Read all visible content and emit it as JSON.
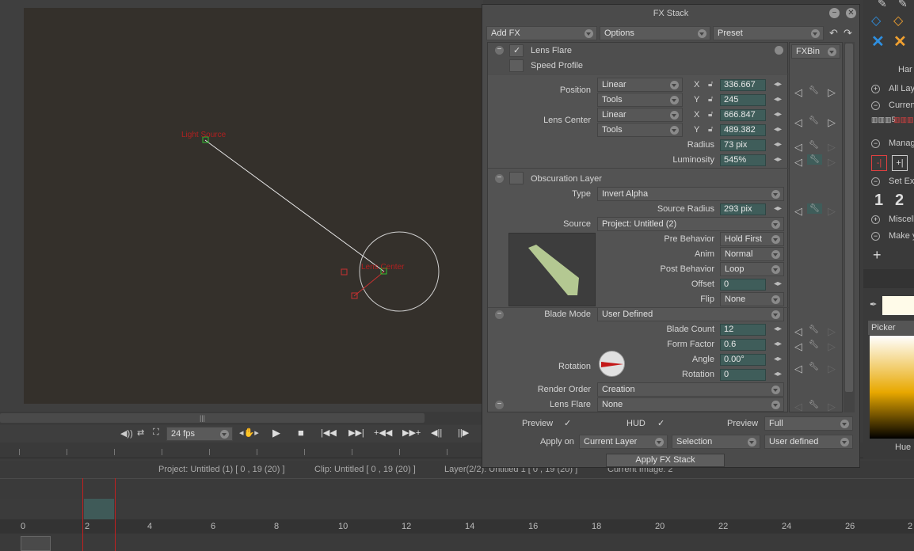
{
  "viewport": {
    "light_source_label": "Light Source",
    "lens_center_label": "Lens Center"
  },
  "transport": {
    "fps": "24 fps"
  },
  "status": {
    "project": "Project: Untitled (1) [ 0 , 19  (20) ]",
    "clip": "Clip: Untitled [ 0 , 19  (20) ]",
    "layer": "Layer(2/2): Untitled 1 [ 0 , 19  (20) ]",
    "image": "Current Image: 2"
  },
  "ruler": [
    "0",
    "2",
    "4",
    "6",
    "8",
    "10",
    "12",
    "14",
    "16",
    "18",
    "20",
    "22",
    "24",
    "26",
    "2"
  ],
  "right_panel": {
    "items": [
      "Har",
      "All Lay",
      "Curren",
      "Manag",
      "Set Ex",
      "Miscell",
      "Make y"
    ],
    "numbers": [
      "1",
      "2"
    ],
    "picker": "Picker",
    "hue": "Hue"
  },
  "fx": {
    "title": "FX Stack",
    "add_fx": "Add FX",
    "options": "Options",
    "preset": "Preset",
    "fxbin": "FXBin",
    "lens_flare": "Lens Flare",
    "speed_profile": "Speed Profile",
    "position": "Position",
    "lens_center": "Lens Center",
    "linear": "Linear",
    "tools": "Tools",
    "x": "X",
    "y": "Y",
    "pos_x": "336.667",
    "pos_y": "245",
    "lc_x": "666.847",
    "lc_y": "489.382",
    "radius_label": "Radius",
    "radius": "73 pix",
    "luminosity_label": "Luminosity",
    "luminosity": "545%",
    "obscuration": "Obscuration Layer",
    "type_label": "Type",
    "type": "Invert Alpha",
    "source_radius_label": "Source Radius",
    "source_radius": "293 pix",
    "source_label": "Source",
    "source": "Project: Untitled (2)",
    "pre_behavior_label": "Pre Behavior",
    "pre_behavior": "Hold First",
    "anim_label": "Anim",
    "anim": "Normal",
    "post_behavior_label": "Post Behavior",
    "post_behavior": "Loop",
    "offset_label": "Offset",
    "offset": "0",
    "flip_label": "Flip",
    "flip": "None",
    "blade_mode_label": "Blade Mode",
    "blade_mode": "User Defined",
    "blade_count_label": "Blade Count",
    "blade_count": "12",
    "form_factor_label": "Form Factor",
    "form_factor": "0.6",
    "angle_label": "Angle",
    "angle": "0.00°",
    "rotation_label": "Rotation",
    "rotation2_label": "Rotation",
    "rotation": "0",
    "render_order_label": "Render Order",
    "render_order": "Creation",
    "lens_flare_label": "Lens Flare",
    "lens_flare_value": "None",
    "preview_label": "Preview",
    "hud_label": "HUD",
    "preview2_label": "Preview",
    "preview_mode": "Full",
    "apply_on_label": "Apply on",
    "apply_layer": "Current Layer",
    "apply_selection": "Selection",
    "apply_user": "User defined",
    "apply_button": "Apply FX Stack"
  }
}
